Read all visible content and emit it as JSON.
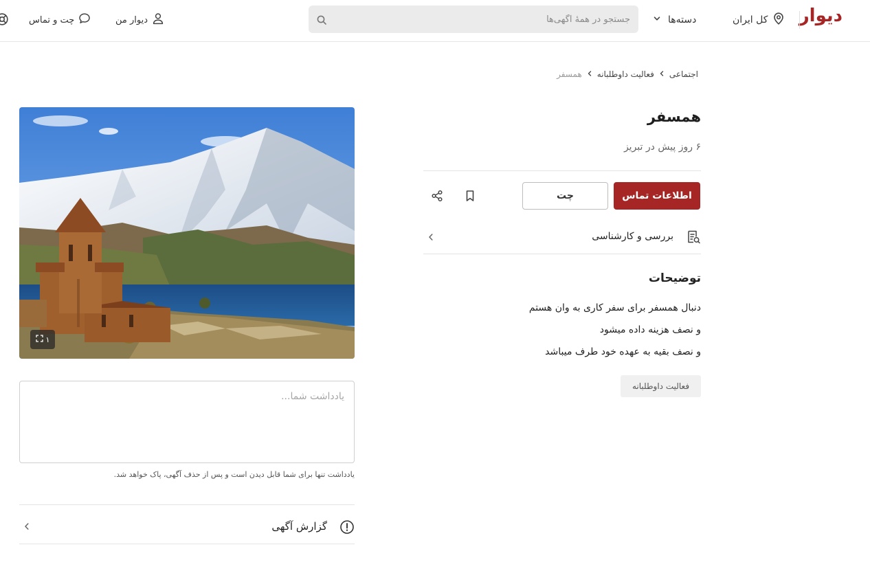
{
  "header": {
    "logo": "دیوار",
    "location": "کل ایران",
    "categories": "دسته‌ها",
    "search_placeholder": "جستجو در همهٔ آگهی‌ها",
    "my_divar": "دیوار من",
    "chat_support": "چت و تماس"
  },
  "breadcrumb": [
    {
      "label": "اجتماعی"
    },
    {
      "label": "فعالیت داوطلبانه"
    },
    {
      "label": "همسفر"
    }
  ],
  "post": {
    "title": "همسفر",
    "subtitle": "۶ روز پیش در تبریز",
    "contact_label": "اطلاعات تماس",
    "chat_label": "چت",
    "review_label": "بررسی و کارشناسی",
    "description_heading": "توضیحات",
    "description_lines": [
      "دنبال همسفر برای سفر کاری به وان هستم",
      "و نصف هزینه داده میشود",
      "و نصف بقیه به عهده خود طرف میباشد"
    ],
    "tag": "فعالیت داوطلبانه"
  },
  "gallery": {
    "count": "۱"
  },
  "note": {
    "placeholder": "یادداشت شما...",
    "hint": "یادداشت تنها برای شما قابل دیدن است و پس از حذف آگهی، پاک خواهد شد."
  },
  "report": {
    "label": "گزارش آگهی"
  },
  "colors": {
    "brand": "#a62626",
    "chip_bg": "#f0f0f0",
    "search_bg": "#ebebeb"
  }
}
